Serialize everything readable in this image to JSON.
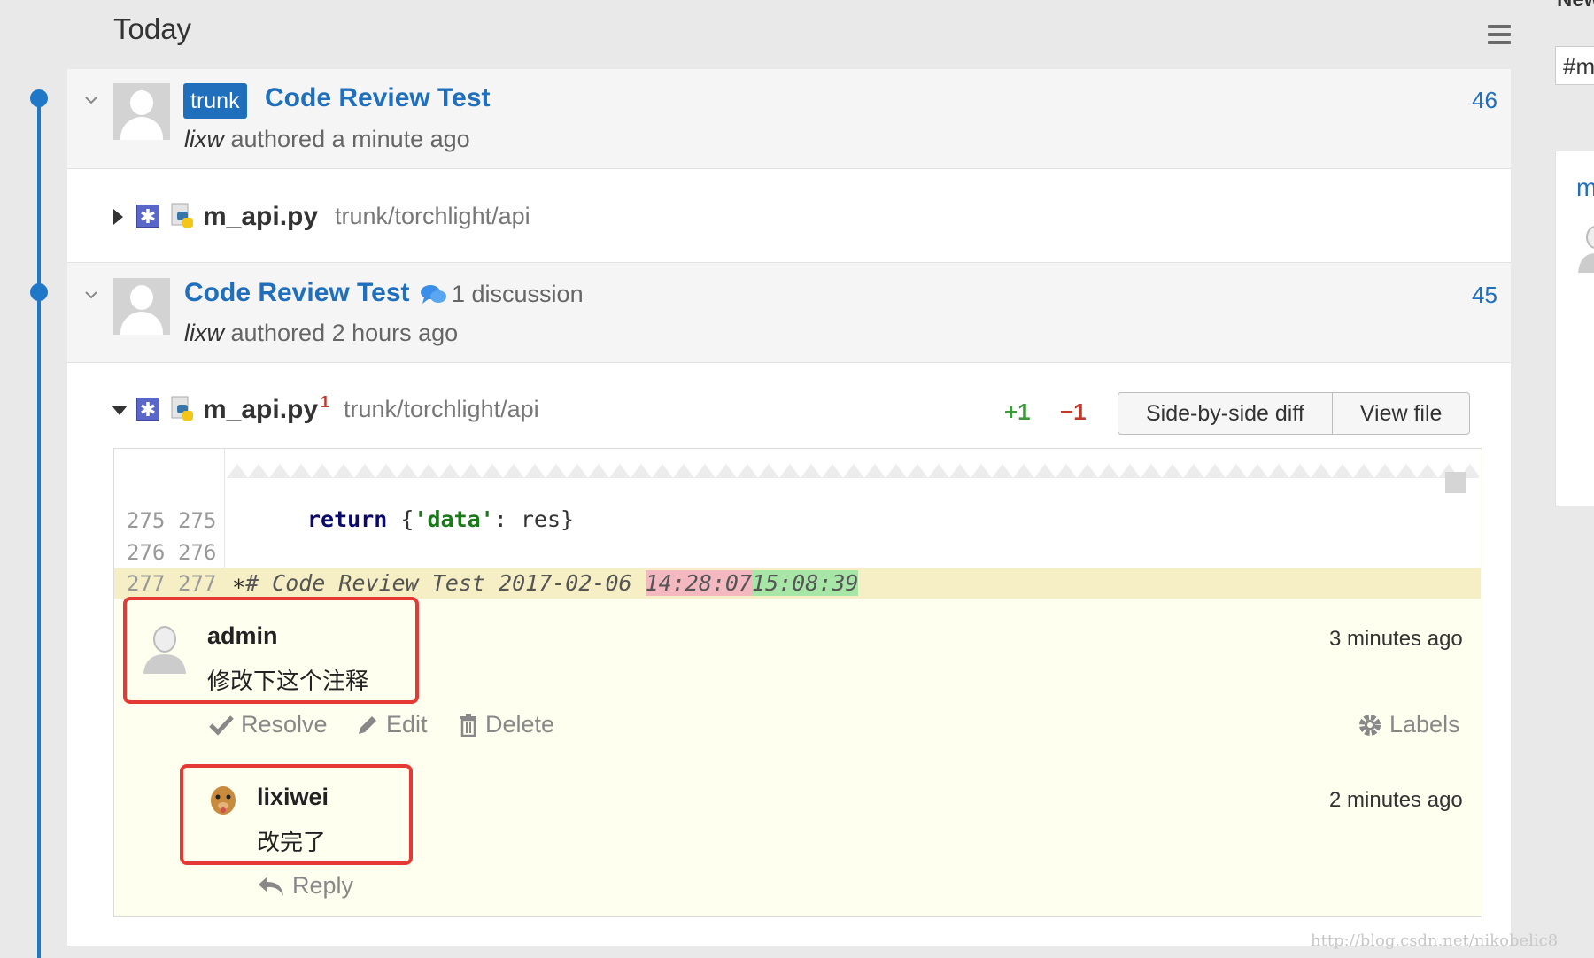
{
  "header": {
    "title": "Today"
  },
  "commits": [
    {
      "branch": "trunk",
      "title": "Code Review Test",
      "author": "lixw",
      "meta": " authored a minute ago",
      "number": "46",
      "file": {
        "name": "m_api.py",
        "path": "trunk/torchlight/api"
      }
    },
    {
      "title": "Code Review Test",
      "discussion": "1 discussion",
      "author": "lixw",
      "meta": " authored 2 hours ago",
      "number": "45",
      "file": {
        "name": "m_api.py",
        "note_count": "1",
        "path": "trunk/torchlight/api",
        "additions": "+1",
        "deletions": "−1",
        "btn_side_by_side": "Side-by-side diff",
        "btn_view_file": "View file"
      }
    }
  ],
  "diff": {
    "lines": [
      {
        "old": "275",
        "new": "275",
        "kw": "return",
        "code_a": " {",
        "str": "'data'",
        "code_b": ": res}"
      },
      {
        "old": "276",
        "new": "276"
      },
      {
        "old": "277",
        "new": "277",
        "marker": "∗",
        "comment_text": "# Code Review Test 2017-02-06 ",
        "old_time": "14:28:07",
        "new_time": "15:08:39"
      }
    ]
  },
  "discussion": {
    "note": {
      "author": "admin",
      "body": "修改下这个注释",
      "time": "3 minutes ago"
    },
    "actions": {
      "resolve": "Resolve",
      "edit": "Edit",
      "delete": "Delete",
      "labels": "Labels"
    },
    "reply": {
      "author": "lixiwei",
      "body": "改完了",
      "time": "2 minutes ago",
      "reply_label": "Reply"
    }
  },
  "right_panel": {
    "heading": "New",
    "input_value": "#m",
    "link": "m"
  },
  "watermark": "http://blog.csdn.net/nikobelic8",
  "colors": {
    "accent": "#1f6fbd",
    "timeline": "#1f78c7",
    "additions": "#3c9a3c",
    "deletions": "#c0392b",
    "highlight_box": "#e53935",
    "comment_bg": "#fffff0"
  }
}
